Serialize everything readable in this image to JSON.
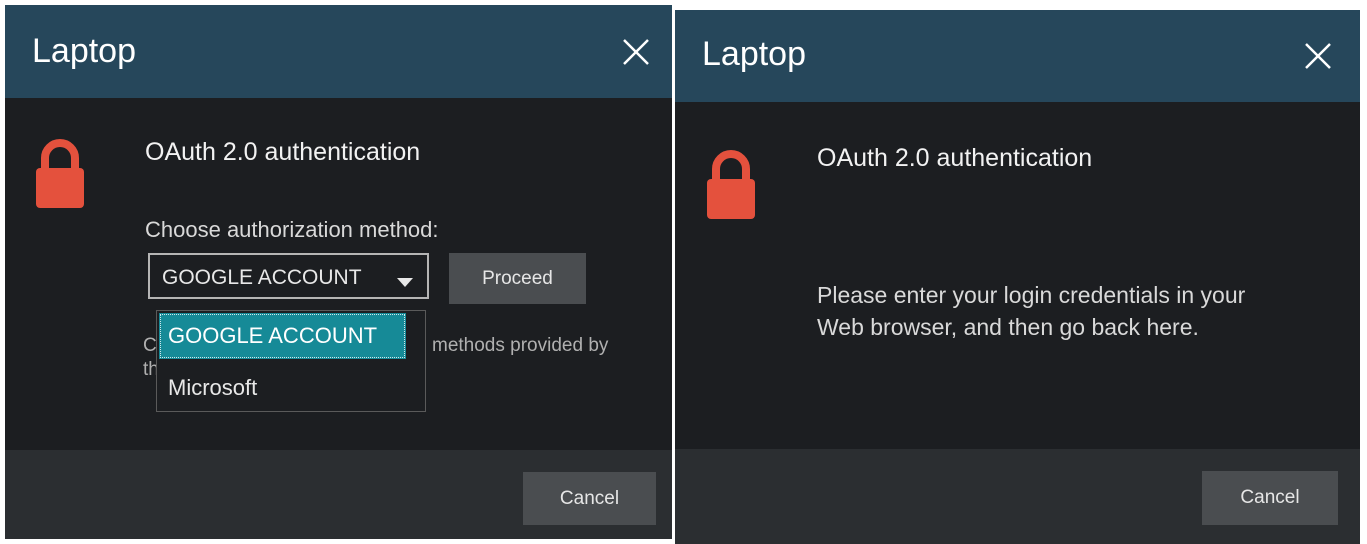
{
  "colors": {
    "titlebar": "#26475b",
    "body": "#1c1e21",
    "footer": "#2b2e31",
    "button": "#4a4d50",
    "lock": "#e4513d",
    "selected_option": "#168a97"
  },
  "left_dialog": {
    "title": "Laptop",
    "close_icon": "close-icon",
    "lock_icon": "lock-icon",
    "heading": "OAuth 2.0 authentication",
    "choose_label": "Choose authorization method:",
    "select": {
      "value": "GOOGLE ACCOUNT"
    },
    "proceed_label": "Proceed",
    "hint_left": "C\nth",
    "hint_right": "methods provided by",
    "dropdown_options": [
      "GOOGLE ACCOUNT",
      "Microsoft"
    ],
    "cancel_label": "Cancel"
  },
  "right_dialog": {
    "title": "Laptop",
    "close_icon": "close-icon",
    "lock_icon": "lock-icon",
    "heading": "OAuth 2.0 authentication",
    "message": "Please enter your login credentials in your Web browser, and then go back here.",
    "cancel_label": "Cancel"
  }
}
